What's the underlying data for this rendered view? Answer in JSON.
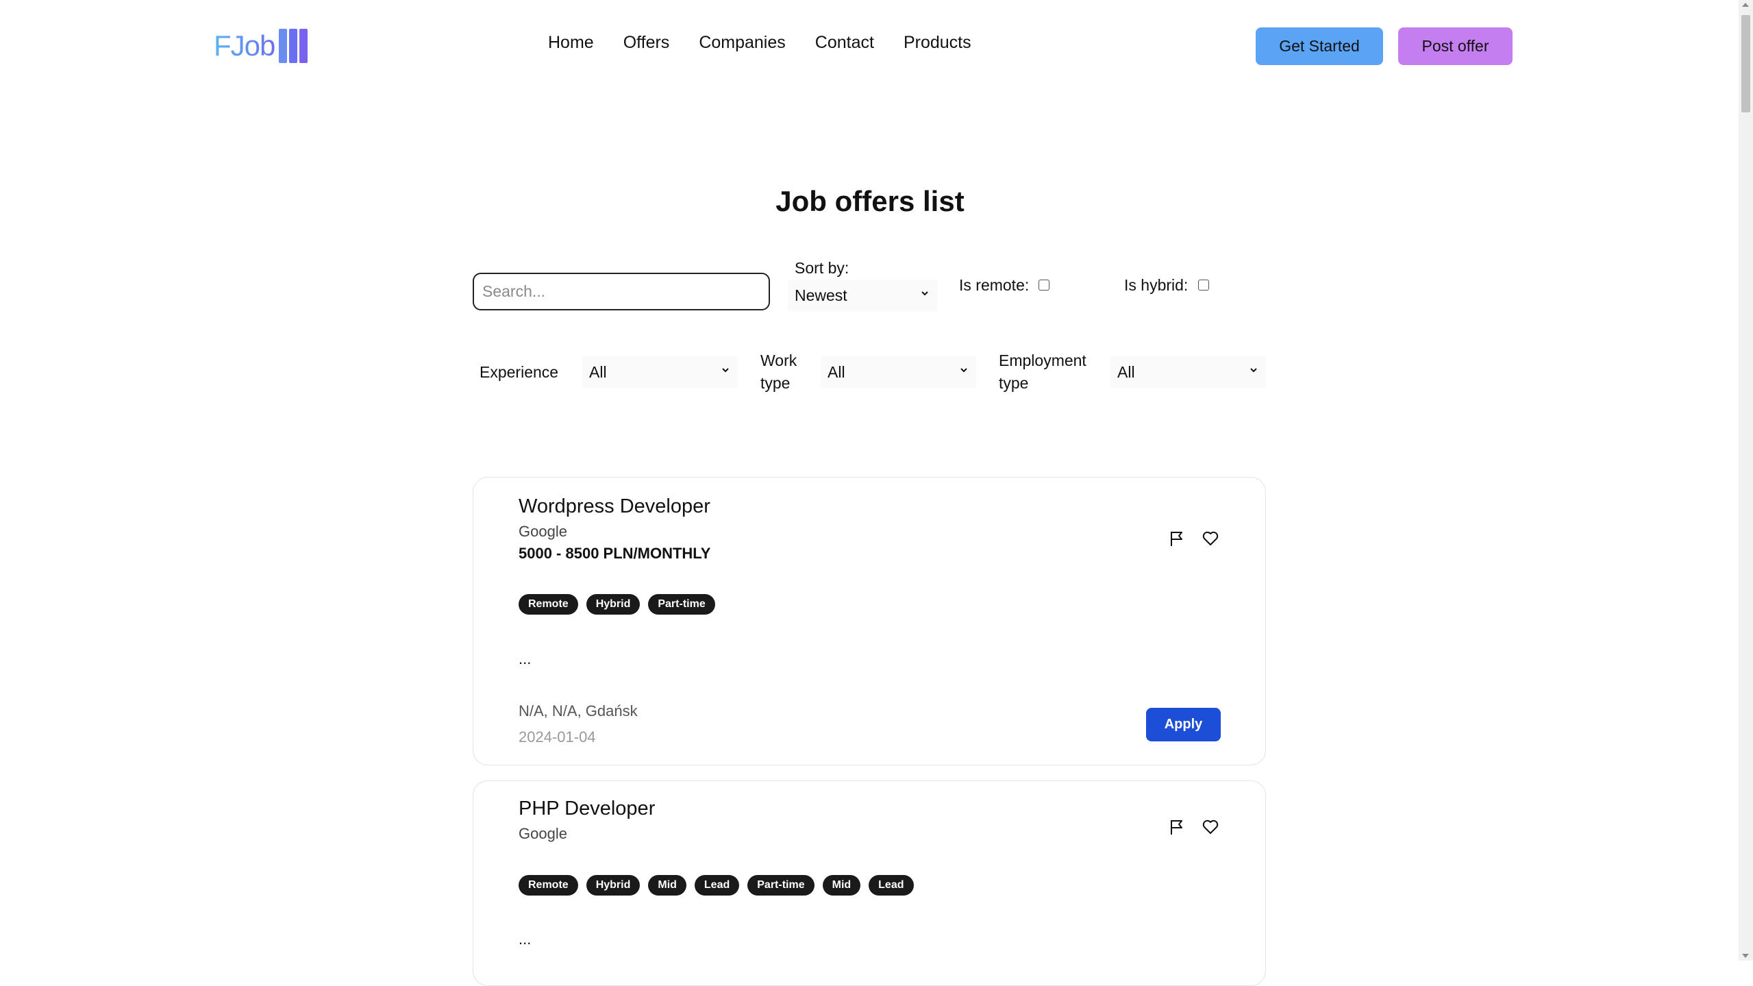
{
  "brand": {
    "name": "FJob",
    "bar_colors": [
      "#6a8cf0",
      "#6a6ff2",
      "#7b61f0"
    ]
  },
  "nav": {
    "items": [
      "Home",
      "Offers",
      "Companies",
      "Contact",
      "Products"
    ]
  },
  "header": {
    "get_started_label": "Get Started",
    "get_started_color": "#5ba3f5",
    "post_offer_label": "Post offer",
    "post_offer_color": "#c57ef0"
  },
  "page": {
    "title": "Job offers list"
  },
  "filters": {
    "search_placeholder": "Search...",
    "search_value": "",
    "sort_label": "Sort by:",
    "sort_value": "Newest",
    "remote_label": "Is remote:",
    "remote_checked": false,
    "hybrid_label": "Is hybrid:",
    "hybrid_checked": false,
    "experience_label": "Experience",
    "experience_value": "All",
    "work_type_label_line1": "Work",
    "work_type_label_line2": "type",
    "work_type_value": "All",
    "employment_type_label_line1": "Employment",
    "employment_type_label_line2": "type",
    "employment_type_value": "All"
  },
  "offers": [
    {
      "title": "Wordpress Developer",
      "company": "Google",
      "salary": "5000 - 8500 PLN/MONTHLY",
      "tags": [
        "Remote",
        "Hybrid",
        "Part-time"
      ],
      "description": "...",
      "location": "N/A, N/A, Gdańsk",
      "date": "2024-01-04",
      "apply_label": "Apply"
    },
    {
      "title": "PHP Developer",
      "company": "Google",
      "tags": [
        "Remote",
        "Hybrid",
        "Mid",
        "Lead",
        "Part-time",
        "Mid",
        "Lead"
      ],
      "description": "..."
    }
  ],
  "icons": {
    "report": "flag-icon",
    "favorite": "heart-icon",
    "dropdown": "chevron-down-icon"
  },
  "colors": {
    "apply_button": "#1d4ed8",
    "tag_background": "#1a1a1a"
  }
}
